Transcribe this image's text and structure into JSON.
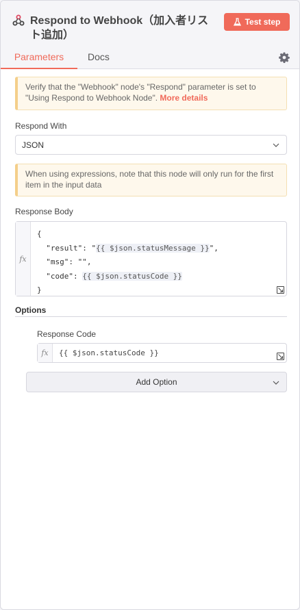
{
  "header": {
    "title": "Respond to Webhook（加入者リスト追加）",
    "node_icon": "webhook-icon",
    "test_button_label": "Test step",
    "test_button_icon": "flask-icon"
  },
  "tabs": [
    {
      "label": "Parameters",
      "active": true
    },
    {
      "label": "Docs",
      "active": false
    }
  ],
  "settings_icon": "gear-icon",
  "notice_respond": {
    "text": "Verify that the \"Webhook\" node's \"Respond\" parameter is set to \"Using Respond to Webhook Node\". ",
    "link": "More details"
  },
  "respond_with": {
    "label": "Respond With",
    "value": "JSON"
  },
  "notice_expressions": {
    "text": "When using expressions, note that this node will only run for the first item in the input data"
  },
  "response_body": {
    "label": "Response Body",
    "fx": "fx",
    "line1": "{",
    "line2_key": "  \"result\": \"",
    "line2_expr": "{{ $json.statusMessage }}",
    "line2_end": "\",",
    "line3": "  \"msg\": \"\",",
    "line4_key": "  \"code\": ",
    "line4_expr": "{{ $json.statusCode }}",
    "line5": "}"
  },
  "options": {
    "title": "Options",
    "response_code_label": "Response Code",
    "response_code_fx": "fx",
    "response_code_value": "{{ $json.statusCode }}",
    "add_option_label": "Add Option"
  },
  "colors": {
    "accent": "#f06a5a",
    "notice_bg": "#fef8ec",
    "notice_border": "#f4cf8a"
  }
}
